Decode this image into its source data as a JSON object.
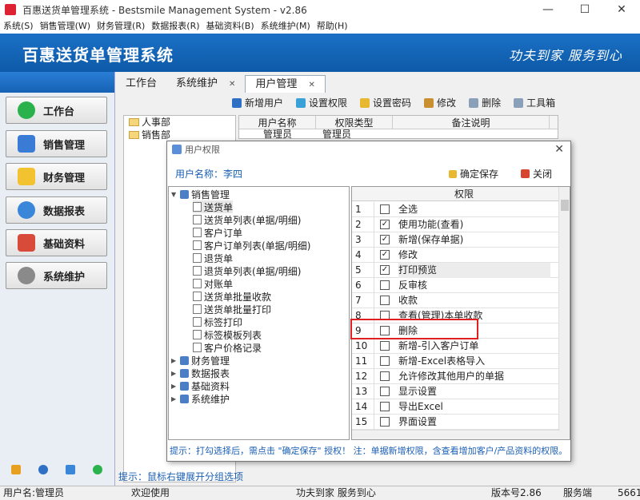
{
  "window": {
    "title": "百惠送货单管理系统 - Bestsmile Management System - v2.86",
    "minimize": "—",
    "maximize": "☐",
    "close": "✕"
  },
  "menu": [
    "系统(S)",
    "销售管理(W)",
    "财务管理(R)",
    "数据报表(R)",
    "基础资料(B)",
    "系统维护(M)",
    "帮助(H)"
  ],
  "banner": {
    "title": "百惠送货单管理系统",
    "slogan": "功夫到家 服务到心"
  },
  "nav": [
    {
      "label": "工作台",
      "icon": "check-icon",
      "color": "#2bb24c"
    },
    {
      "label": "销售管理",
      "icon": "window-icon",
      "color": "#3a7bd5"
    },
    {
      "label": "财务管理",
      "icon": "folder-icon",
      "color": "#f2c230"
    },
    {
      "label": "数据报表",
      "icon": "magnifier-icon",
      "color": "#3a86d8"
    },
    {
      "label": "基础资料",
      "icon": "cubes-icon",
      "color": "#d84a3a"
    },
    {
      "label": "系统维护",
      "icon": "gear-icon",
      "color": "#8a8a8a"
    }
  ],
  "tabs": [
    {
      "label": "工作台"
    },
    {
      "label": "系统维护",
      "close": "✕"
    },
    {
      "label": "用户管理",
      "close": "✕"
    }
  ],
  "toolbar": [
    "新增用户",
    "设置权限",
    "设置密码",
    "修改",
    "删除",
    "工具箱"
  ],
  "dept_tree": [
    "人事部",
    "销售部"
  ],
  "user_grid": {
    "headers": [
      "用户名称",
      "权限类型",
      "备注说明"
    ],
    "row": [
      "管理员",
      "管理员",
      ""
    ]
  },
  "main_hint": "提示：鼠标右键展开分组选项",
  "status": {
    "user": "用户名:管理员",
    "welcome": "欢迎使用",
    "slogan": "功夫到家 服务到心",
    "version": "版本号2.86",
    "server": "服务端",
    "port": "5661"
  },
  "dialog": {
    "title": "用户权限",
    "close": "✕",
    "user_label": "用户名称：李四",
    "save": "确定保存",
    "close_btn": "关闭",
    "tree": {
      "root": "销售管理",
      "children": [
        "送货单",
        "送货单列表(单据/明细)",
        "客户订单",
        "客户订单列表(单据/明细)",
        "退货单",
        "退货单列表(单据/明细)",
        "对账单",
        "送货单批量收款",
        "送货单批量打印",
        "标签打印",
        "标签模板列表",
        "客户价格记录"
      ],
      "others": [
        "财务管理",
        "数据报表",
        "基础资料",
        "系统维护"
      ]
    },
    "grid_header": "权限",
    "rows": [
      {
        "n": "1",
        "label": "全选",
        "checked": false
      },
      {
        "n": "2",
        "label": "使用功能(查看)",
        "checked": true
      },
      {
        "n": "3",
        "label": "新增(保存单据)",
        "checked": true
      },
      {
        "n": "4",
        "label": "修改",
        "checked": true
      },
      {
        "n": "5",
        "label": "打印预览",
        "checked": true
      },
      {
        "n": "6",
        "label": "反审核",
        "checked": false
      },
      {
        "n": "7",
        "label": "收款",
        "checked": false
      },
      {
        "n": "8",
        "label": "查看(管理)本单收款",
        "checked": false
      },
      {
        "n": "9",
        "label": "删除",
        "checked": false
      },
      {
        "n": "10",
        "label": "新增-引入客户订单",
        "checked": false
      },
      {
        "n": "11",
        "label": "新增-Excel表格导入",
        "checked": false
      },
      {
        "n": "12",
        "label": "允许修改其他用户的单据",
        "checked": false
      },
      {
        "n": "13",
        "label": "显示设置",
        "checked": false
      },
      {
        "n": "14",
        "label": "导出Excel",
        "checked": false
      },
      {
        "n": "15",
        "label": "界面设置",
        "checked": false
      }
    ],
    "hint": "提示：打勾选择后，需点击 \"确定保存\" 授权！ 注：单据新增权限，含查看增加客户/产品资料的权限。"
  }
}
